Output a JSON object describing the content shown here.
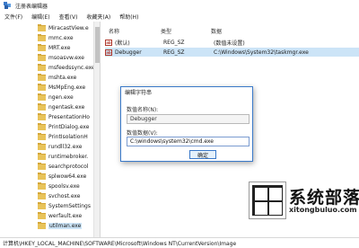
{
  "window": {
    "title": "注册表编辑器"
  },
  "menu": [
    "文件(F)",
    "编辑(E)",
    "查看(V)",
    "收藏夹(A)",
    "帮助(H)"
  ],
  "tree": {
    "items": [
      {
        "label": "MiracastView.e"
      },
      {
        "label": "mmc.exe"
      },
      {
        "label": "MRT.exe"
      },
      {
        "label": "msoasvw.exe"
      },
      {
        "label": "msfeedssync.exe"
      },
      {
        "label": "mshta.exe"
      },
      {
        "label": "MsMpEng.exe"
      },
      {
        "label": "ngen.exe"
      },
      {
        "label": "ngentask.exe"
      },
      {
        "label": "PresentationHo"
      },
      {
        "label": "PrintDialog.exe"
      },
      {
        "label": "PrintIsolationH"
      },
      {
        "label": "rundll32.exe"
      },
      {
        "label": "runtimebroker."
      },
      {
        "label": "searchprotocol"
      },
      {
        "label": "splwow64.exe"
      },
      {
        "label": "spoolsv.exe"
      },
      {
        "label": "svchost.exe"
      },
      {
        "label": "SystemSettings"
      },
      {
        "label": "werfault.exe"
      },
      {
        "label": "utilman.exe"
      }
    ]
  },
  "columns": {
    "name": "名称",
    "type": "类型",
    "data": "数据"
  },
  "values": [
    {
      "icon": "ab",
      "name": "(默认)",
      "type": "REG_SZ",
      "data": "(数值未设置)"
    },
    {
      "icon": "ab",
      "name": "Debugger",
      "type": "REG_SZ",
      "data": "C:\\Windows\\System32\\taskmgr.exe"
    }
  ],
  "status_bar": {
    "path": "计算机\\HKEY_LOCAL_MACHINE\\SOFTWARE\\Microsoft\\Windows NT\\CurrentVersion\\Image"
  },
  "dialog": {
    "title": "编辑字符串",
    "name_label": "数值名称(N):",
    "name_value": "Debugger",
    "data_label": "数值数据(V):",
    "data_value": "C:\\windows\\system32\\cmd.exe",
    "ok_label": "确定",
    "cancel_label": "取消"
  },
  "watermark": {
    "brand": "系统部落",
    "url": "xitongbuluo.com"
  },
  "colors": {
    "selection": "#cce4f7",
    "folder": "#e8c35a",
    "accent": "#3a79c9"
  }
}
